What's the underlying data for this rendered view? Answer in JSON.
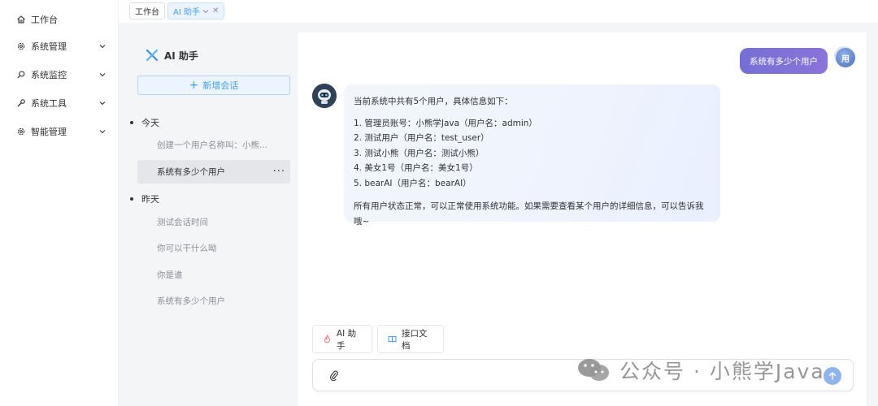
{
  "nav": {
    "items": [
      {
        "label": "工作台",
        "icon": "home-icon",
        "expandable": false
      },
      {
        "label": "系统管理",
        "icon": "gear-icon",
        "expandable": true
      },
      {
        "label": "系统监控",
        "icon": "search-icon",
        "expandable": true
      },
      {
        "label": "系统工具",
        "icon": "wrench-icon",
        "expandable": true
      },
      {
        "label": "智能管理",
        "icon": "gear-icon",
        "expandable": true
      }
    ]
  },
  "tabs": [
    {
      "label": "工作台",
      "active": false
    },
    {
      "label": "AI 助手",
      "active": true
    }
  ],
  "sessions": {
    "title": "AI 助手",
    "new_label": "新增会话",
    "groups": [
      {
        "label": "今天",
        "items": [
          "创建一个用户名称叫：小熊...",
          "系统有多少个用户"
        ]
      },
      {
        "label": "昨天",
        "items": [
          "测试会话时间",
          "你可以干什么呦",
          "你是谁",
          "系统有多少个用户"
        ]
      }
    ],
    "active_item": "系统有多少个用户",
    "more_label": "···"
  },
  "chat": {
    "user_message": "系统有多少个用户",
    "user_avatar_text": "用",
    "bot_reply": {
      "intro": "当前系统中共有5个用户，具体信息如下：",
      "list": [
        "1. 管理员账号：小熊学Java（用户名：admin）",
        "2. 测试用户（用户名：test_user）",
        "3. 测试小熊（用户名：测试小熊）",
        "4. 美女1号（用户名：美女1号）",
        "5. bearAI（用户名：bearAI）"
      ],
      "outro": "所有用户状态正常，可以正常使用系统功能。如果需要查看某个用户的详细信息，可以告诉我哦~"
    },
    "chips": [
      {
        "label": "AI 助手",
        "icon": "fire-icon"
      },
      {
        "label": "接口文档",
        "icon": "book-icon"
      }
    ],
    "input": {
      "value": "",
      "placeholder": ""
    }
  },
  "watermark": "公众号 · 小熊学Java",
  "colors": {
    "accent": "#409eff",
    "user_bubble": "#7a71d8",
    "bot_bubble": "#eef3fd",
    "page_bg": "#f4f5f7"
  }
}
